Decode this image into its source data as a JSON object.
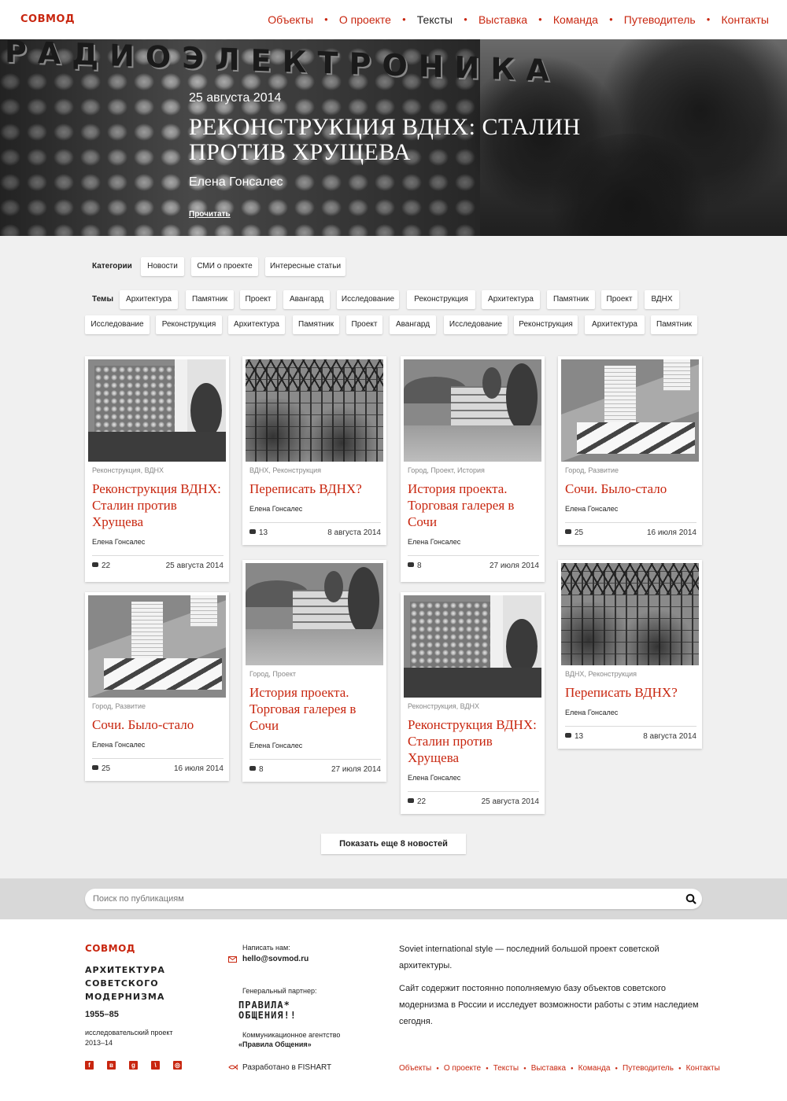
{
  "header": {
    "logo": "СОВМОД",
    "nav": [
      "Объекты",
      "О проекте",
      "Тексты",
      "Выставка",
      "Команда",
      "Путеводитель",
      "Контакты"
    ],
    "active": "Тексты"
  },
  "hero": {
    "sign": "РАДИОЭЛЕКТРОНИКА",
    "date": "25 августа 2014",
    "title": "РЕКОНСТРУКЦИЯ ВДНХ: СТАЛИН ПРОТИВ ХРУЩЕВА",
    "author": "Елена Гонсалес",
    "read": "Прочитать"
  },
  "filters": {
    "categories_label": "Категории",
    "categories": [
      "Новости",
      "СМИ о проекте",
      "Интересные статьи"
    ],
    "topics_label": "Темы",
    "topics_row1": [
      "Архитектура",
      "Памятник",
      "Проект",
      "Авангард",
      "Исследование",
      "Реконструкция",
      "Архитектура",
      "Памятник",
      "Проект",
      "ВДНХ"
    ],
    "topics_row2": [
      "Исследование",
      "Реконструкция",
      "Архитектура",
      "Памятник",
      "Проект",
      "Авангард",
      "Исследование",
      "Реконструкция",
      "Архитектура",
      "Памятник"
    ]
  },
  "cards": [
    {
      "cats": "Реконструкция, ВДНХ",
      "title": "Реконструкция ВДНХ: Сталин против Хрущева",
      "author": "Елена Гонсалес",
      "comments": "22",
      "date": "25 августа 2014",
      "img": "a"
    },
    {
      "cats": "ВДНХ, Реконструкция",
      "title": "Переписать ВДНХ?",
      "author": "Елена Гонсалес",
      "comments": "13",
      "date": "8 августа 2014",
      "img": "b"
    },
    {
      "cats": "Город, Проект, История",
      "title": "История проекта. Торговая галерея в Сочи",
      "author": "Елена Гонсалес",
      "comments": "8",
      "date": "27 июля 2014",
      "img": "c"
    },
    {
      "cats": "Город, Развитие",
      "title": "Сочи. Было-стало",
      "author": "Елена Гонсалес",
      "comments": "25",
      "date": "16 июля 2014",
      "img": "d"
    },
    {
      "cats": "Город, Развитие",
      "title": "Сочи. Было-стало",
      "author": "Елена Гонсалес",
      "comments": "25",
      "date": "16 июля 2014",
      "img": "d"
    },
    {
      "cats": "Город, Проект",
      "title": "История проекта. Торговая галерея в Сочи",
      "author": "Елена Гонсалес",
      "comments": "8",
      "date": "27 июля 2014",
      "img": "c"
    },
    {
      "cats": "Реконструкция, ВДНХ",
      "title": "Реконструкция ВДНХ: Сталин против Хрущева",
      "author": "Елена Гонсалес",
      "comments": "22",
      "date": "25 августа 2014",
      "img": "a"
    },
    {
      "cats": "ВДНХ, Реконструкция",
      "title": "Переписать ВДНХ?",
      "author": "Елена Гонсалес",
      "comments": "13",
      "date": "8 августа 2014",
      "img": "b"
    }
  ],
  "more_button": "Показать еще 8 новостей",
  "search": {
    "placeholder": "Поиск по публикациям",
    "icon": "search-icon"
  },
  "footer": {
    "logo": "СОВМОД",
    "tagline": "АРХИТЕКТУРА СОВЕТСКОГО МОДЕРНИЗМА",
    "years": "1955–85",
    "project_line1": "исследовательский проект",
    "project_line2": "2013–14",
    "write_label": "Написать нам:",
    "email": "hello@sovmod.ru",
    "partner_label": "Генеральный партнер:",
    "partner_logo_line1": "ПРАВИЛА*",
    "partner_logo_line2": "ОБЩЕНИЯ!!",
    "agency_line1": "Коммуникационное агентство",
    "agency_line2": "«Правила Общения»",
    "developed": "Разработано в FISHART",
    "about1": "Soviet international style — последний большой проект советской архитектуры.",
    "about2": "Сайт содержит постоянно пополняемую базу объектов советского модернизма в России и исследует возможности работы с этим наследием сегодня.",
    "social": [
      "facebook-icon",
      "vkontakte-icon",
      "google-plus-icon",
      "livejournal-icon",
      "instagram-icon"
    ],
    "social_glyphs": [
      "f",
      "в",
      "g",
      "\\",
      "◎"
    ],
    "nav": [
      "Объекты",
      "О проекте",
      "Тексты",
      "Выставка",
      "Команда",
      "Путеводитель",
      "Контакты"
    ]
  },
  "colors": {
    "accent": "#c8260f",
    "background": "#f0f0f0"
  }
}
